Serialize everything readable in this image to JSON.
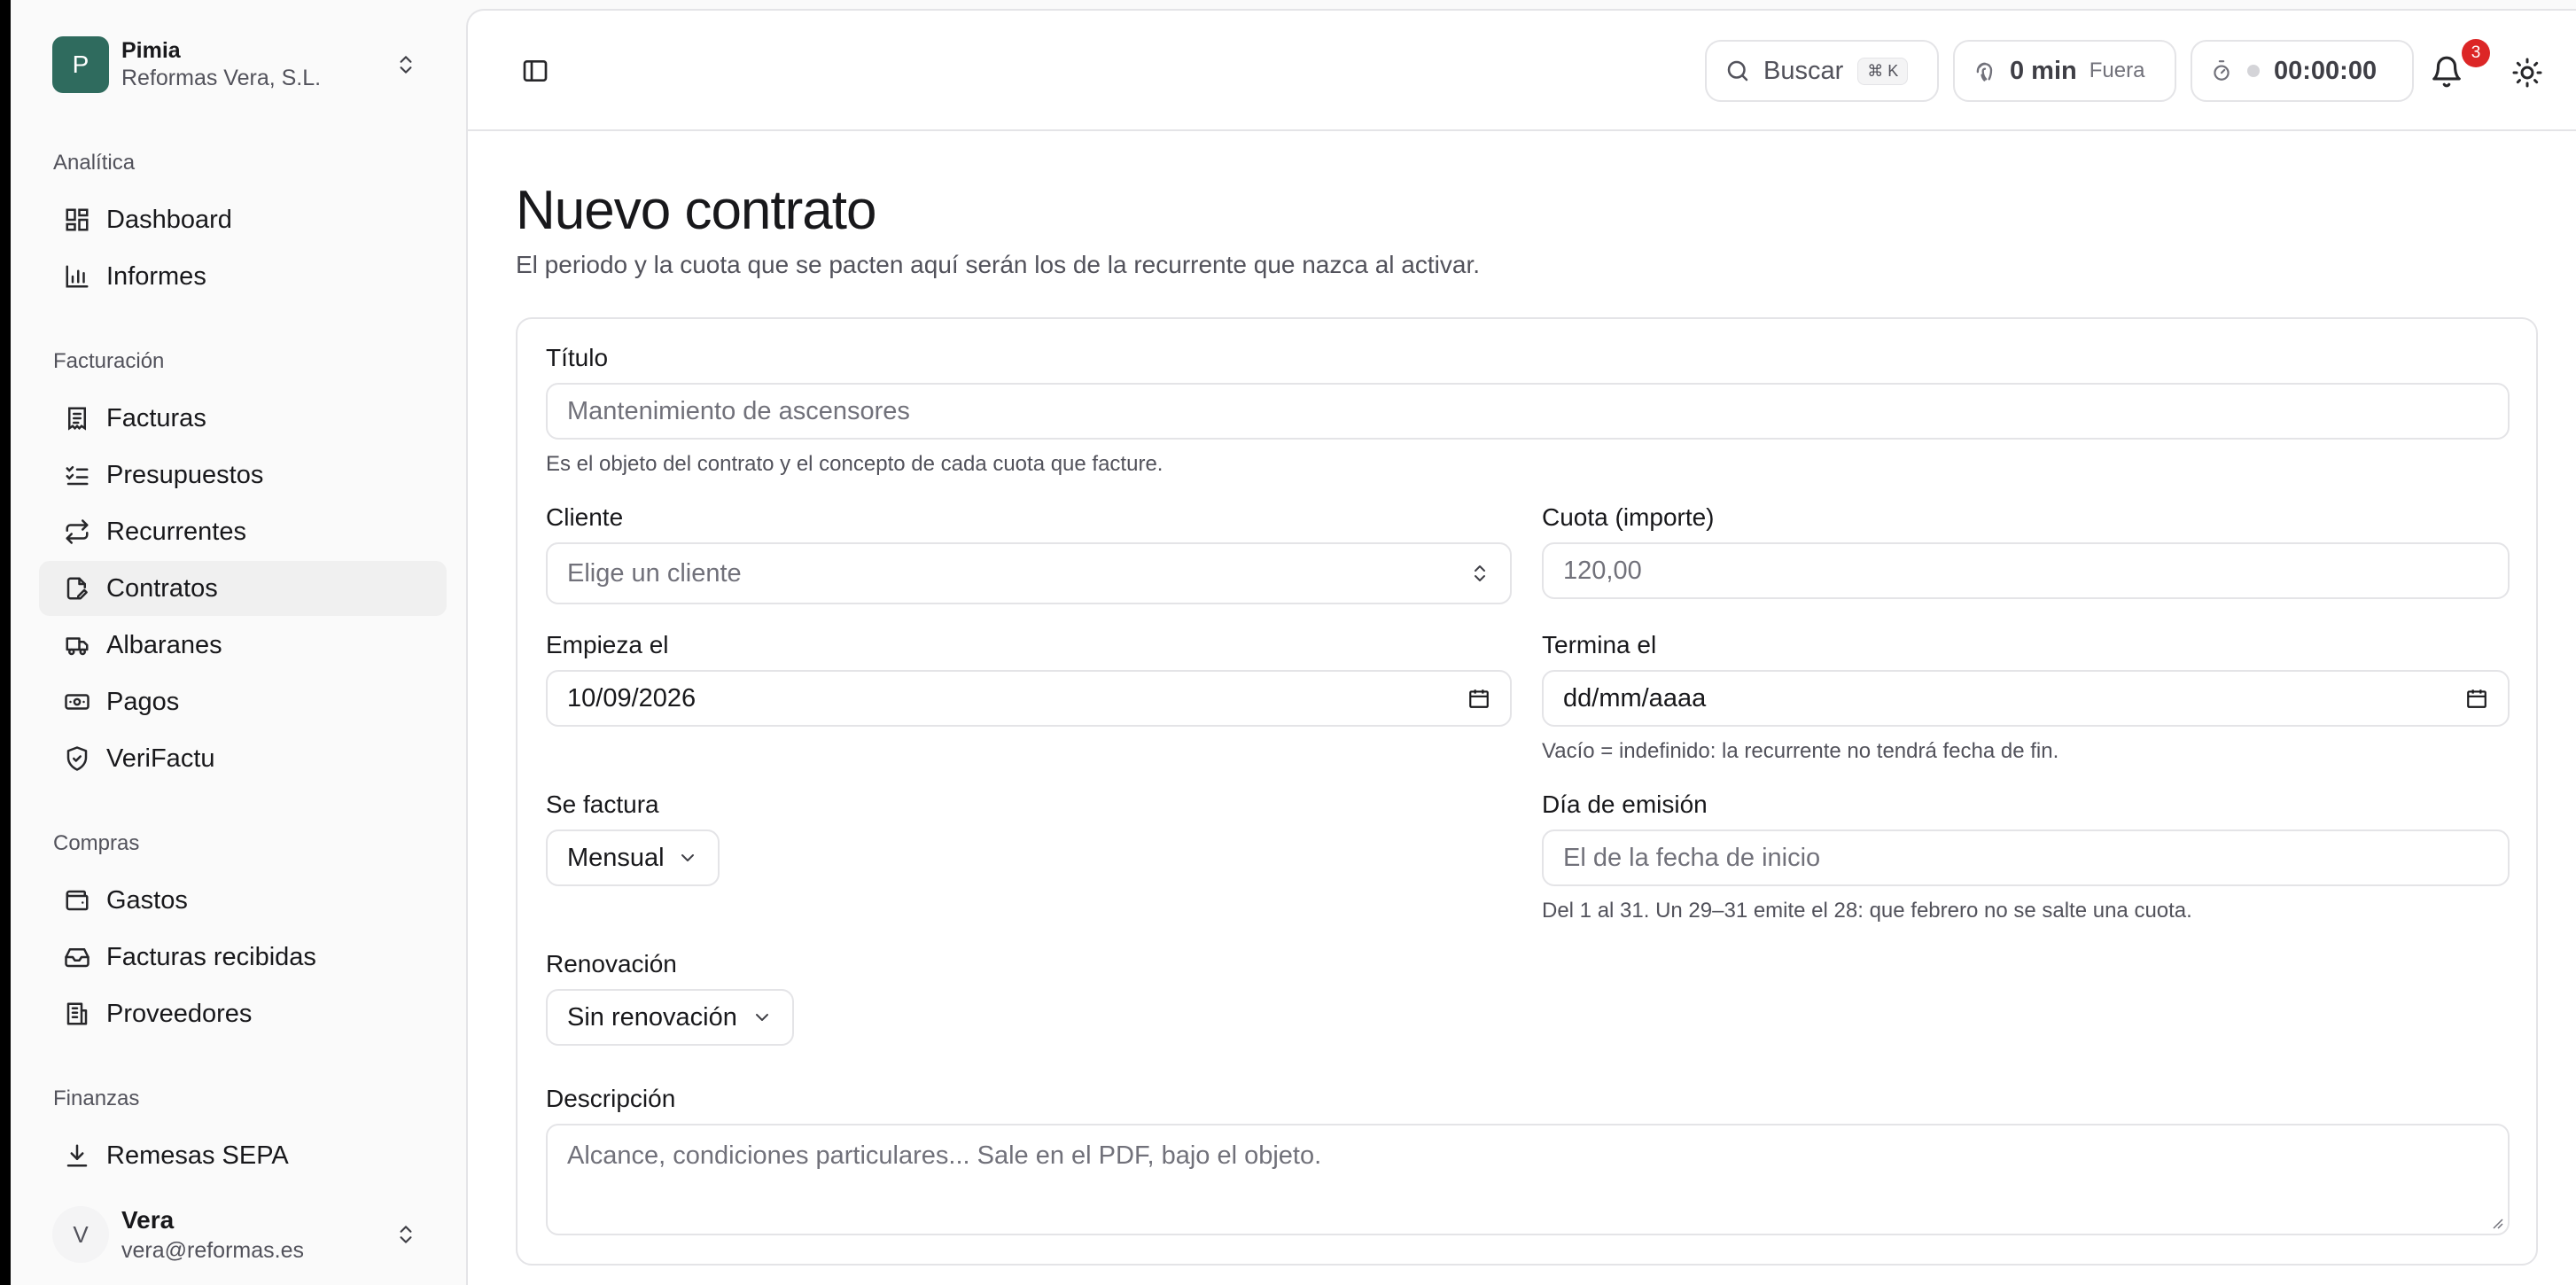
{
  "org": {
    "initial": "P",
    "name": "Pimia",
    "company": "Reformas Vera, S.L."
  },
  "nav": {
    "groups": [
      {
        "title": "Analítica",
        "items": [
          "Dashboard",
          "Informes"
        ]
      },
      {
        "title": "Facturación",
        "items": [
          "Facturas",
          "Presupuestos",
          "Recurrentes",
          "Contratos",
          "Albaranes",
          "Pagos",
          "VeriFactu"
        ]
      },
      {
        "title": "Compras",
        "items": [
          "Gastos",
          "Facturas recibidas",
          "Proveedores"
        ]
      },
      {
        "title": "Finanzas",
        "items": [
          "Remesas SEPA"
        ]
      }
    ],
    "active": "Contratos"
  },
  "user": {
    "initial": "V",
    "name": "Vera",
    "email": "vera@reformas.es"
  },
  "topbar": {
    "search_label": "Buscar",
    "search_shortcut": "⌘ K",
    "presence_time": "0 min",
    "presence_status": "Fuera",
    "timer": "00:00:00",
    "notifications_count": "3"
  },
  "page": {
    "title": "Nuevo contrato",
    "subtitle": "El periodo y la cuota que se pacten aquí serán los de la recurrente que nazca al activar."
  },
  "form": {
    "titulo": {
      "label": "Título",
      "placeholder": "Mantenimiento de ascensores",
      "help": "Es el objeto del contrato y el concepto de cada cuota que facture."
    },
    "cliente": {
      "label": "Cliente",
      "placeholder": "Elige un cliente"
    },
    "cuota": {
      "label": "Cuota (importe)",
      "placeholder": "120,00"
    },
    "empieza": {
      "label": "Empieza el",
      "value": "10/09/2026"
    },
    "termina": {
      "label": "Termina el",
      "value": "dd/mm/aaaa",
      "help": "Vacío = indefinido: la recurrente no tendrá fecha de fin."
    },
    "factura": {
      "label": "Se factura",
      "value": "Mensual"
    },
    "emision": {
      "label": "Día de emisión",
      "placeholder": "El de la fecha de inicio",
      "help": "Del 1 al 31. Un 29–31 emite el 28: que febrero no se salte una cuota."
    },
    "renovacion": {
      "label": "Renovación",
      "value": "Sin renovación"
    },
    "descripcion": {
      "label": "Descripción",
      "placeholder": "Alcance, condiciones particulares... Sale en el PDF, bajo el objeto."
    }
  }
}
